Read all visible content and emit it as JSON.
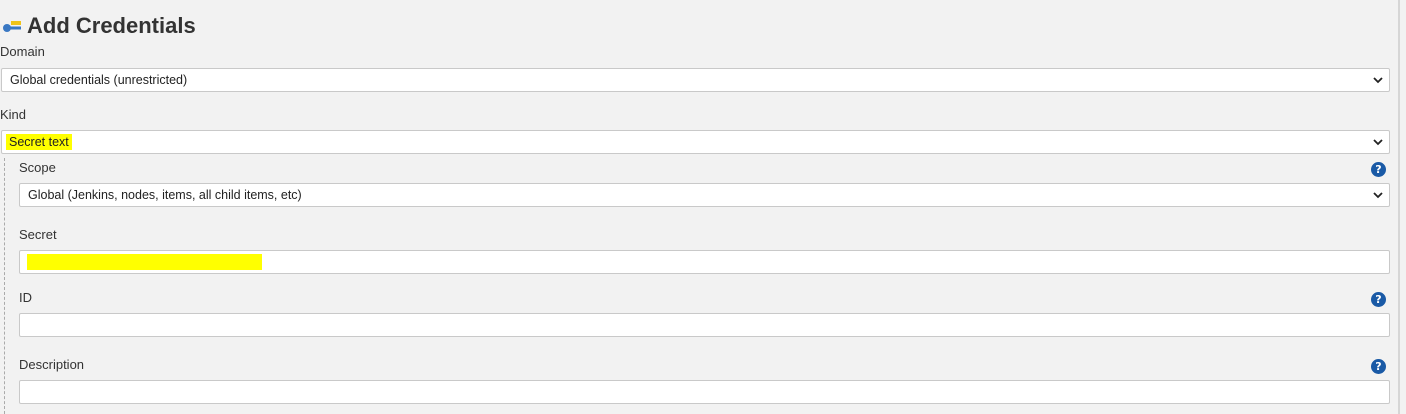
{
  "page": {
    "title": "Add Credentials",
    "title_icon": "key-icon"
  },
  "form": {
    "domain": {
      "label": "Domain",
      "value": "Global credentials (unrestricted)"
    },
    "kind": {
      "label": "Kind",
      "value": "Secret text"
    },
    "scope": {
      "label": "Scope",
      "value": "Global (Jenkins, nodes, items, all child items, etc)",
      "help_icon": "help-icon"
    },
    "secret": {
      "label": "Secret",
      "value": ""
    },
    "id": {
      "label": "ID",
      "value": "",
      "help_icon": "help-icon"
    },
    "description": {
      "label": "Description",
      "value": "",
      "help_icon": "help-icon"
    }
  },
  "colors": {
    "highlight": "#ffff00",
    "help_icon": "#1a5aa6",
    "background": "#f2f2f2"
  }
}
